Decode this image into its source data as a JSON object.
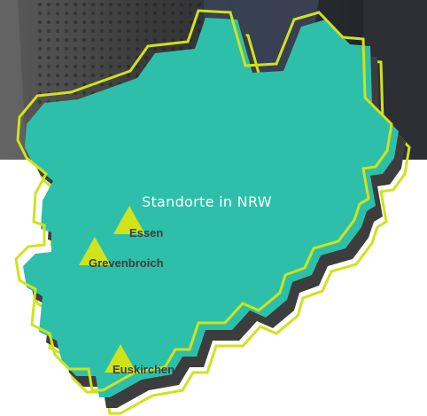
{
  "map": {
    "title": "Standorte in NRW",
    "colors": {
      "fill": "#2ebfaa",
      "outline": "#cfe31a",
      "shadow": "#3d3d3d",
      "marker": "#cfe31a",
      "label": "#3d3d3d",
      "title": "#ffffff"
    },
    "locations": [
      {
        "name": "Essen"
      },
      {
        "name": "Grevenbroich"
      },
      {
        "name": "Euskirchen"
      }
    ]
  }
}
